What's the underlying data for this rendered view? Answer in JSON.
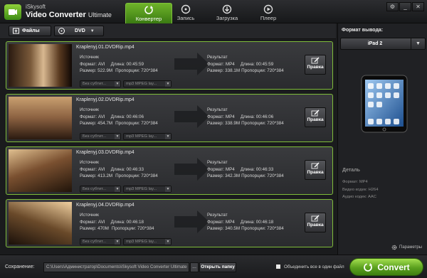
{
  "app": {
    "brand_small": "iSkysoft",
    "brand_name": "Video Converter",
    "brand_edition": "Ultimate"
  },
  "tabs": [
    {
      "label": "Конвертер",
      "icon": "refresh-icon",
      "active": true
    },
    {
      "label": "Запись",
      "icon": "disc-icon",
      "active": false
    },
    {
      "label": "Загрузка",
      "icon": "download-icon",
      "active": false
    },
    {
      "label": "Плеер",
      "icon": "play-icon",
      "active": false
    }
  ],
  "window_buttons": {
    "settings": "⚙",
    "minimize": "_",
    "close": "✕"
  },
  "toolbar": {
    "files_label": "Файлы",
    "dvd_label": "DVD"
  },
  "items": [
    {
      "filename": "Kraplenyj.01.DVDRip.mp4",
      "src_title": "Источник",
      "src_format": "Формат: AVI",
      "src_duration": "Длина: 00:45:59",
      "src_size": "Размер: 522.9M",
      "src_res": "Пропорции: 720*384",
      "dst_title": "Результат",
      "dst_format": "Формат: MP4",
      "dst_duration": "Длина: 00:45:59",
      "dst_size": "Размер: 338.1M",
      "dst_res": "Пропорции: 720*384",
      "subtitle": "Без субтит...",
      "audio": "mp3 MPEG lay...",
      "edit": "Правка"
    },
    {
      "filename": "Kraplenyj.02.DVDRip.mp4",
      "src_title": "Источник",
      "src_format": "Формат: AVI",
      "src_duration": "Длина: 00:46:06",
      "src_size": "Размер: 454.7M",
      "src_res": "Пропорции: 720*384",
      "dst_title": "Результат",
      "dst_format": "Формат: MP4",
      "dst_duration": "Длина: 00:46:06",
      "dst_size": "Размер: 338.9M",
      "dst_res": "Пропорции: 720*384",
      "subtitle": "Без субтит...",
      "audio": "mp3 MPEG lay...",
      "edit": "Правка"
    },
    {
      "filename": "Kraplenyj.03.DVDRip.mp4",
      "src_title": "Источник",
      "src_format": "Формат: AVI",
      "src_duration": "Длина: 00:46:33",
      "src_size": "Размер: 413.2M",
      "src_res": "Пропорции: 720*384",
      "dst_title": "Результат",
      "dst_format": "Формат: MP4",
      "dst_duration": "Длина: 00:46:33",
      "dst_size": "Размер: 342.3M",
      "dst_res": "Пропорции: 720*384",
      "subtitle": "Без субтит...",
      "audio": "mp3 MPEG lay...",
      "edit": "Правка"
    },
    {
      "filename": "Kraplenyj.04.DVDRip.mp4",
      "src_title": "Источник",
      "src_format": "Формат: AVI",
      "src_duration": "Длина: 00:46:18",
      "src_size": "Размер: 470M",
      "src_res": "Пропорции: 720*384",
      "dst_title": "Результат",
      "dst_format": "Формат: MP4",
      "dst_duration": "Длина: 00:46:18",
      "dst_size": "Размер: 340.5M",
      "dst_res": "Пропорции: 720*384",
      "subtitle": "Без субтит...",
      "audio": "mp3 MPEG lay...",
      "edit": "Правка"
    }
  ],
  "output": {
    "label": "Формат вывода:",
    "selected": "iPad 2",
    "detail_title": "Деталь",
    "detail_format": "Формат: MP4",
    "detail_video": "Видео кодек: H264",
    "detail_audio": "Аудио кодек: AAC",
    "params_label": "Параметры"
  },
  "bottom": {
    "save_label": "Сохранение:",
    "path": "C:\\Users\\Администратор\\Documents\\iSkysoft Video Converter Ultimate",
    "browse": "...",
    "open_folder": "Открыть папку",
    "merge_label": "Объединить все в один файл",
    "merge_checked": false,
    "convert": "Convert"
  },
  "colors": {
    "accent": "#6fb32a",
    "item_border": "#7fbd3a",
    "background": "#1a1b1d"
  }
}
